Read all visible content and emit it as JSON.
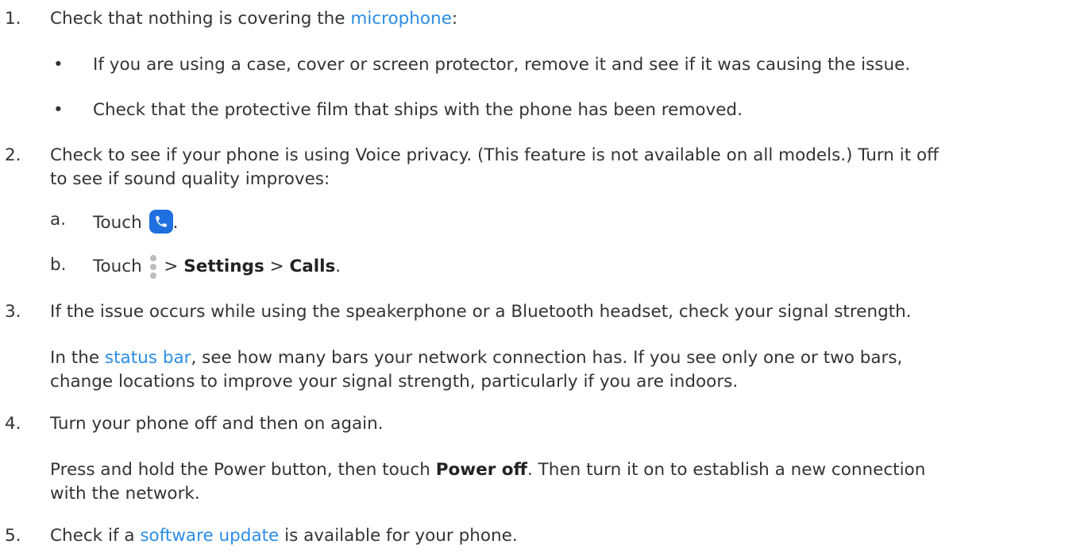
{
  "steps": [
    {
      "num": "1.",
      "text_before": "Check that nothing is covering the ",
      "link": "microphone",
      "text_after": ":",
      "bullets": [
        "If you are using a case, cover or screen protector, remove it and see if it was causing the issue.",
        "Check that the protective film that ships with the phone has been removed."
      ],
      "bullet_char": "•"
    },
    {
      "num": "2.",
      "line1": "Check to see if your phone is using Voice privacy. (This feature is not available on all models.) Turn it off",
      "line2": "to see if sound quality improves:",
      "sub_a": {
        "letter": "a.",
        "touch": "Touch",
        "icon": "phone-icon",
        "after": "."
      },
      "sub_b": {
        "letter": "b.",
        "touch": "Touch",
        "icon": "more-vert-icon",
        "sep1": " > ",
        "settings": "Settings",
        "sep2": " > ",
        "calls": "Calls",
        "after": "."
      }
    },
    {
      "num": "3.",
      "line1": "If the issue occurs while using the speakerphone or a Bluetooth headset, check your signal strength.",
      "para_before": "In the ",
      "para_link": "status bar",
      "para_after1": ", see how many bars your network connection has. If you see only one or two bars,",
      "para_line2": "change locations to improve your signal strength, particularly if you are indoors."
    },
    {
      "num": "4.",
      "line1": "Turn your phone off and then on again.",
      "para_before": "Press and hold the Power button, then touch ",
      "para_bold": "Power off",
      "para_after1": ". Then turn it on to establish a new connection",
      "para_line2": "with the network."
    },
    {
      "num": "5.",
      "text_before": "Check if a ",
      "link": "software update",
      "text_after": " is available for your phone."
    }
  ],
  "colors": {
    "text": "#333333",
    "link": "#2b8ce6",
    "phone_icon_bg": "#1f6fe0",
    "more_icon": "#b9bcc0"
  }
}
